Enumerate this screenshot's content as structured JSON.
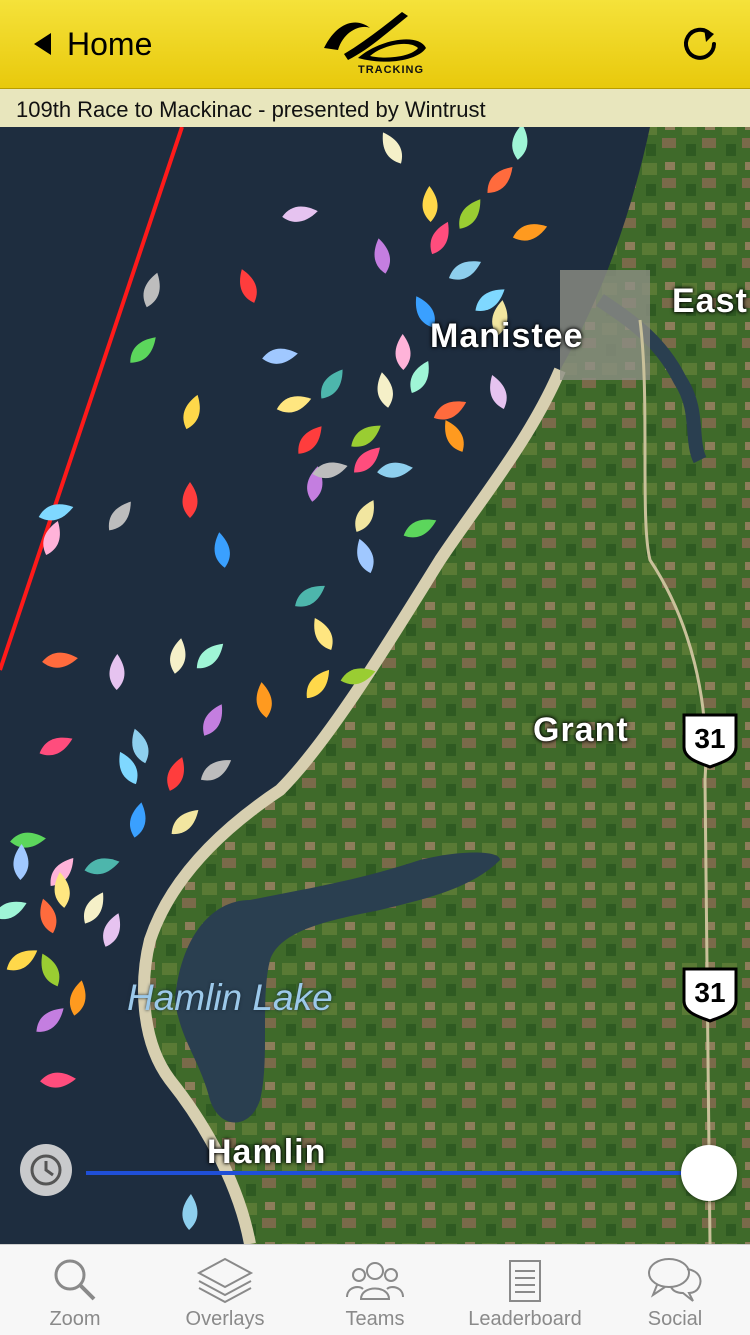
{
  "header": {
    "back_label": "Home",
    "logo_text": "TRACKING",
    "brand_color": "#f2dc2c"
  },
  "race_title": "109th Race to Mackinac - presented by Wintrust",
  "map": {
    "places": {
      "manistee": "Manistee",
      "east": "East",
      "grant": "Grant",
      "hamlin": "Hamlin"
    },
    "lake_label": "Hamlin Lake",
    "highway_1": "31",
    "highway_2": "31",
    "course_line_color": "#ff1a1a"
  },
  "timeline": {
    "icon": "clock-icon",
    "slider_fraction": 1.0
  },
  "tabs": [
    {
      "label": "Zoom",
      "icon": "magnifier-icon"
    },
    {
      "label": "Overlays",
      "icon": "layers-icon"
    },
    {
      "label": "Teams",
      "icon": "people-icon"
    },
    {
      "label": "Leaderboard",
      "icon": "notepad-icon"
    },
    {
      "label": "Social",
      "icon": "chat-bubbles-icon"
    }
  ]
}
